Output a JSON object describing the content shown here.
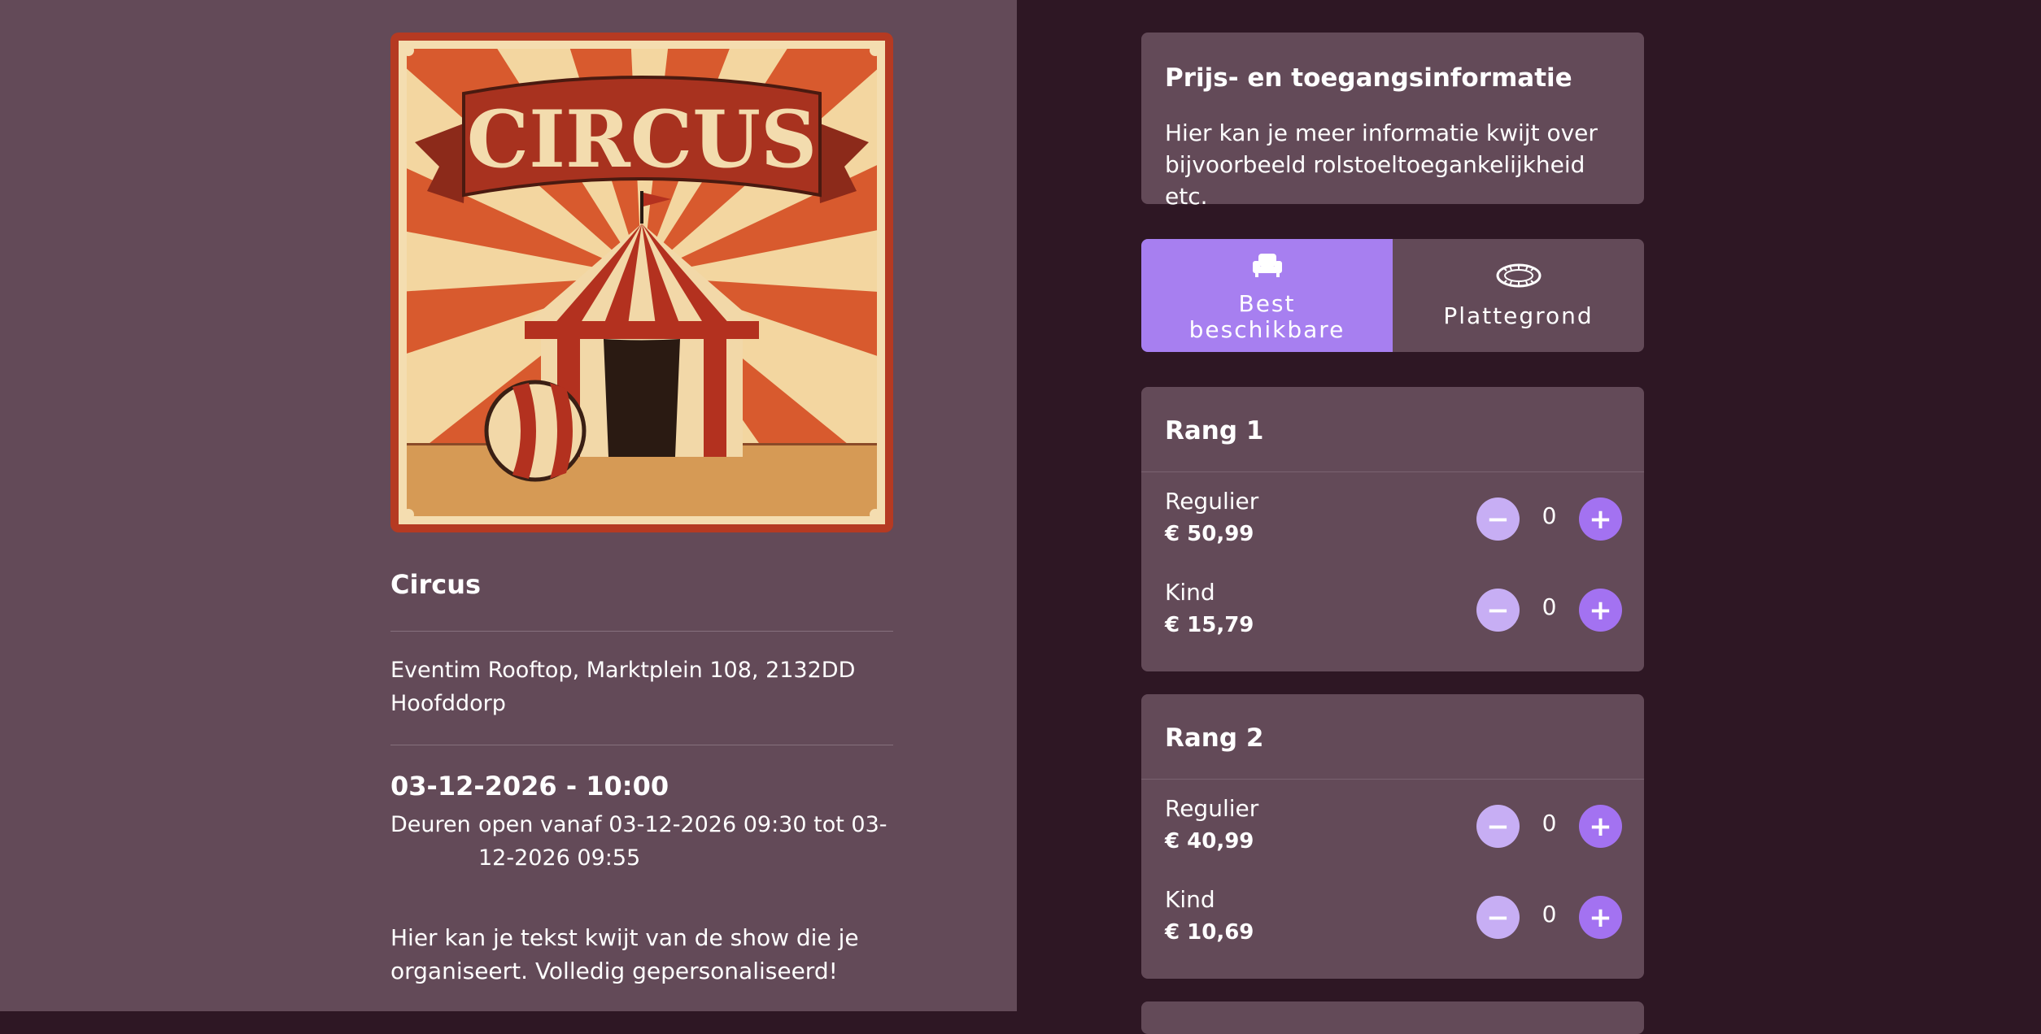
{
  "poster": {
    "banner_text": "CIRCUS"
  },
  "event": {
    "title": "Circus",
    "venue": "Eventim Rooftop, Marktplein 108, 2132DD Hoofddorp",
    "datetime": "03-12-2026 - 10:00",
    "doors_label": "Deuren",
    "doors_text": "open vanaf 03-12-2026 09:30  tot 03-12-2026 09:55",
    "description": "Hier kan je tekst kwijt van de show die je organiseert. Volledig gepersonaliseerd!"
  },
  "info": {
    "title": "Prijs- en toegangsinformatie",
    "body": "Hier kan je meer informatie kwijt over bijvoorbeeld rolstoeltoegankelijkheid etc."
  },
  "view_toggle": {
    "best_available_line1": "Best",
    "best_available_line2": "beschikbare",
    "floorplan": "Plattegrond",
    "best_available_icon": "armchair-icon",
    "floorplan_icon": "stadium-icon"
  },
  "ranks": [
    {
      "title": "Rang 1",
      "tickets": [
        {
          "name": "Regulier",
          "price": "€ 50,99",
          "qty": "0"
        },
        {
          "name": "Kind",
          "price": "€ 15,79",
          "qty": "0"
        }
      ]
    },
    {
      "title": "Rang 2",
      "tickets": [
        {
          "name": "Regulier",
          "price": "€ 40,99",
          "qty": "0"
        },
        {
          "name": "Kind",
          "price": "€ 10,69",
          "qty": "0"
        }
      ]
    }
  ],
  "buttons": {
    "minus": "−",
    "plus": "+"
  },
  "colors": {
    "left_bg": "#634a58",
    "right_bg": "#2e1724",
    "card_bg": "#634a58",
    "accent": "#a77ff0",
    "minus_btn": "#c7aef4",
    "plus_btn": "#a372f1"
  }
}
